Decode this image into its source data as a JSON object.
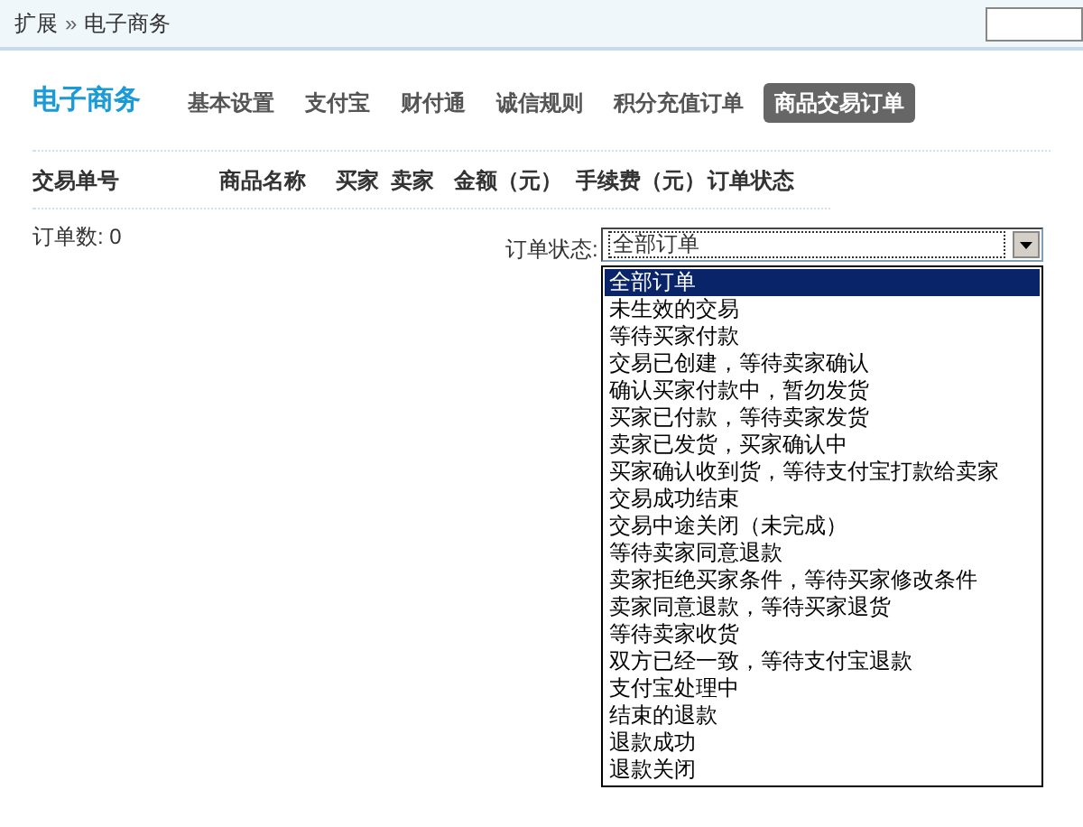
{
  "breadcrumb": {
    "items": [
      "扩展",
      "电子商务"
    ],
    "separator": "»"
  },
  "section_title": "电子商务",
  "tabs": [
    {
      "label": "基本设置",
      "selected": false
    },
    {
      "label": "支付宝",
      "selected": false
    },
    {
      "label": "财付通",
      "selected": false
    },
    {
      "label": "诚信规则",
      "selected": false
    },
    {
      "label": "积分充值订单",
      "selected": false
    },
    {
      "label": "商品交易订单",
      "selected": true
    }
  ],
  "table": {
    "columns": [
      "交易单号",
      "商品名称",
      "买家",
      "卖家",
      "金额（元）",
      "手续费（元）",
      "订单状态"
    ]
  },
  "order_count": {
    "label": "订单数:",
    "value": "0"
  },
  "status_filter": {
    "label": "订单状态:",
    "value": "全部订单",
    "options": [
      {
        "label": "全部订单",
        "selected": true
      },
      {
        "label": "未生效的交易",
        "selected": false
      },
      {
        "label": "等待买家付款",
        "selected": false
      },
      {
        "label": "交易已创建，等待卖家确认",
        "selected": false
      },
      {
        "label": "确认买家付款中，暂勿发货",
        "selected": false
      },
      {
        "label": "买家已付款，等待卖家发货",
        "selected": false
      },
      {
        "label": "卖家已发货，买家确认中",
        "selected": false
      },
      {
        "label": "买家确认收到货，等待支付宝打款给卖家",
        "selected": false
      },
      {
        "label": "交易成功结束",
        "selected": false
      },
      {
        "label": "交易中途关闭（未完成）",
        "selected": false
      },
      {
        "label": "等待卖家同意退款",
        "selected": false
      },
      {
        "label": "卖家拒绝买家条件，等待买家修改条件",
        "selected": false
      },
      {
        "label": "卖家同意退款，等待买家退货",
        "selected": false
      },
      {
        "label": "等待卖家收货",
        "selected": false
      },
      {
        "label": "双方已经一致，等待支付宝退款",
        "selected": false
      },
      {
        "label": "支付宝处理中",
        "selected": false
      },
      {
        "label": "结束的退款",
        "selected": false
      },
      {
        "label": "退款成功",
        "selected": false
      },
      {
        "label": "退款关闭",
        "selected": false
      }
    ]
  }
}
